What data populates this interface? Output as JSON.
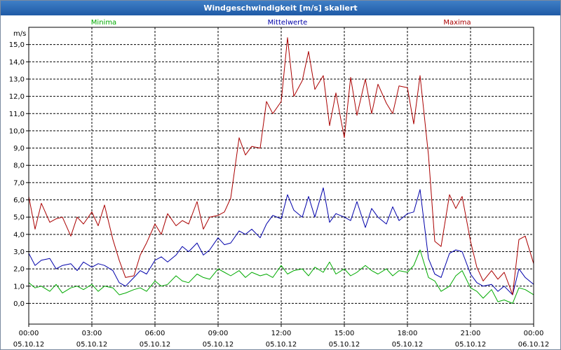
{
  "window": {
    "title": "Windgeschwindigkeit [m/s] skaliert"
  },
  "chart_data": {
    "type": "line",
    "title": "Windgeschwindigkeit [m/s] skaliert",
    "ylabel": "m/s",
    "ylim": [
      -1.2,
      16.0
    ],
    "xlim": [
      0,
      24
    ],
    "grid": true,
    "legend_position": "top",
    "y_ticks": [
      "0,0",
      "1,0",
      "2,0",
      "3,0",
      "4,0",
      "5,0",
      "6,0",
      "7,0",
      "8,0",
      "9,0",
      "10,0",
      "11,0",
      "12,0",
      "13,0",
      "14,0",
      "15,0"
    ],
    "x_ticks": [
      {
        "time": "00:00",
        "date": "05.10.12"
      },
      {
        "time": "03:00",
        "date": "05.10.12"
      },
      {
        "time": "06:00",
        "date": "05.10.12"
      },
      {
        "time": "09:00",
        "date": "05.10.12"
      },
      {
        "time": "12:00",
        "date": "05.10.12"
      },
      {
        "time": "15:00",
        "date": "05.10.12"
      },
      {
        "time": "18:00",
        "date": "05.10.12"
      },
      {
        "time": "21:00",
        "date": "05.10.12"
      },
      {
        "time": "00:00",
        "date": "06.10.12"
      }
    ],
    "series": [
      {
        "name": "Minima",
        "color": "#00aa00",
        "x": [
          0,
          0.3,
          0.6,
          1,
          1.3,
          1.6,
          2,
          2.3,
          2.6,
          3,
          3.3,
          3.6,
          4,
          4.3,
          4.6,
          5,
          5.3,
          5.6,
          6,
          6.3,
          6.6,
          7,
          7.3,
          7.6,
          8,
          8.3,
          8.6,
          9,
          9.3,
          9.6,
          10,
          10.3,
          10.6,
          11,
          11.3,
          11.6,
          12,
          12.3,
          12.6,
          13,
          13.3,
          13.6,
          14,
          14.3,
          14.6,
          15,
          15.3,
          15.6,
          16,
          16.3,
          16.6,
          17,
          17.3,
          17.6,
          18,
          18.3,
          18.6,
          19,
          19.3,
          19.6,
          20,
          20.3,
          20.6,
          21,
          21.3,
          21.6,
          22,
          22.3,
          22.6,
          23,
          23.3,
          23.6,
          24
        ],
        "y": [
          1.2,
          0.9,
          1.0,
          0.7,
          1.1,
          0.6,
          0.9,
          1.0,
          0.8,
          1.1,
          0.7,
          1.0,
          0.9,
          0.5,
          0.6,
          0.8,
          0.9,
          0.7,
          1.3,
          1.0,
          1.1,
          1.6,
          1.3,
          1.2,
          1.7,
          1.5,
          1.4,
          2.0,
          1.8,
          1.6,
          1.9,
          1.5,
          1.8,
          1.6,
          1.7,
          1.5,
          2.2,
          1.7,
          1.9,
          2.0,
          1.6,
          2.1,
          1.8,
          2.4,
          1.7,
          2.0,
          1.6,
          1.8,
          2.2,
          1.9,
          1.7,
          2.0,
          1.6,
          1.9,
          1.8,
          2.2,
          3.1,
          1.5,
          1.3,
          0.7,
          1.0,
          1.6,
          1.9,
          0.9,
          0.7,
          0.3,
          0.8,
          0.1,
          0.2,
          0.0,
          0.9,
          0.8,
          0.5
        ]
      },
      {
        "name": "Mittelwerte",
        "color": "#0000aa",
        "x": [
          0,
          0.3,
          0.6,
          1,
          1.3,
          1.6,
          2,
          2.3,
          2.6,
          3,
          3.3,
          3.6,
          4,
          4.3,
          4.6,
          5,
          5.3,
          5.6,
          6,
          6.3,
          6.6,
          7,
          7.3,
          7.6,
          8,
          8.3,
          8.6,
          9,
          9.3,
          9.6,
          10,
          10.3,
          10.6,
          11,
          11.3,
          11.6,
          12,
          12.3,
          12.6,
          13,
          13.3,
          13.6,
          14,
          14.3,
          14.6,
          15,
          15.3,
          15.6,
          16,
          16.3,
          16.6,
          17,
          17.3,
          17.6,
          18,
          18.3,
          18.6,
          19,
          19.3,
          19.6,
          20,
          20.3,
          20.6,
          21,
          21.3,
          21.6,
          22,
          22.3,
          22.6,
          23,
          23.3,
          23.6,
          24
        ],
        "y": [
          2.9,
          2.2,
          2.5,
          2.6,
          2.0,
          2.2,
          2.3,
          1.9,
          2.4,
          2.1,
          2.3,
          2.2,
          1.9,
          1.2,
          1.0,
          1.5,
          1.9,
          1.7,
          2.5,
          2.7,
          2.4,
          2.8,
          3.3,
          3.0,
          3.5,
          2.8,
          3.1,
          3.8,
          3.4,
          3.5,
          4.2,
          4.0,
          4.3,
          3.8,
          4.6,
          5.1,
          4.9,
          6.3,
          5.4,
          5.0,
          6.2,
          5.0,
          6.7,
          4.7,
          5.2,
          5.0,
          4.8,
          5.9,
          4.4,
          5.5,
          5.0,
          4.6,
          5.6,
          4.8,
          5.2,
          5.3,
          6.6,
          2.6,
          1.7,
          1.5,
          2.9,
          3.1,
          3.0,
          1.7,
          1.2,
          1.0,
          1.1,
          0.7,
          1.0,
          0.5,
          2.0,
          1.5,
          1.1
        ]
      },
      {
        "name": "Maxima",
        "color": "#aa0000",
        "x": [
          0,
          0.3,
          0.6,
          1,
          1.3,
          1.6,
          2,
          2.3,
          2.6,
          3,
          3.3,
          3.6,
          4,
          4.3,
          4.6,
          5,
          5.3,
          5.6,
          6,
          6.3,
          6.6,
          7,
          7.3,
          7.6,
          8,
          8.3,
          8.6,
          9,
          9.3,
          9.6,
          10,
          10.3,
          10.6,
          11,
          11.3,
          11.6,
          12,
          12.3,
          12.6,
          13,
          13.3,
          13.6,
          14,
          14.3,
          14.6,
          15,
          15.3,
          15.6,
          16,
          16.3,
          16.6,
          17,
          17.3,
          17.6,
          18,
          18.3,
          18.6,
          19,
          19.3,
          19.6,
          20,
          20.3,
          20.6,
          21,
          21.3,
          21.6,
          22,
          22.3,
          22.6,
          23,
          23.3,
          23.6,
          24
        ],
        "y": [
          6.2,
          4.3,
          5.8,
          4.7,
          4.9,
          5.0,
          3.9,
          5.0,
          4.6,
          5.3,
          4.5,
          5.7,
          3.7,
          2.5,
          1.5,
          1.6,
          2.8,
          3.5,
          4.6,
          4.0,
          5.2,
          4.5,
          4.8,
          4.6,
          5.9,
          4.3,
          5.0,
          5.1,
          5.3,
          6.1,
          9.6,
          8.6,
          9.1,
          9.0,
          11.7,
          11.0,
          11.7,
          15.4,
          12.0,
          12.9,
          14.6,
          12.4,
          13.2,
          10.3,
          12.2,
          9.6,
          13.1,
          10.9,
          13.0,
          11.0,
          12.7,
          11.6,
          11.0,
          12.6,
          12.5,
          10.4,
          13.2,
          8.6,
          3.6,
          3.3,
          6.3,
          5.5,
          6.2,
          3.6,
          2.1,
          1.3,
          1.9,
          1.4,
          1.8,
          0.5,
          3.7,
          3.9,
          2.3
        ]
      }
    ]
  }
}
